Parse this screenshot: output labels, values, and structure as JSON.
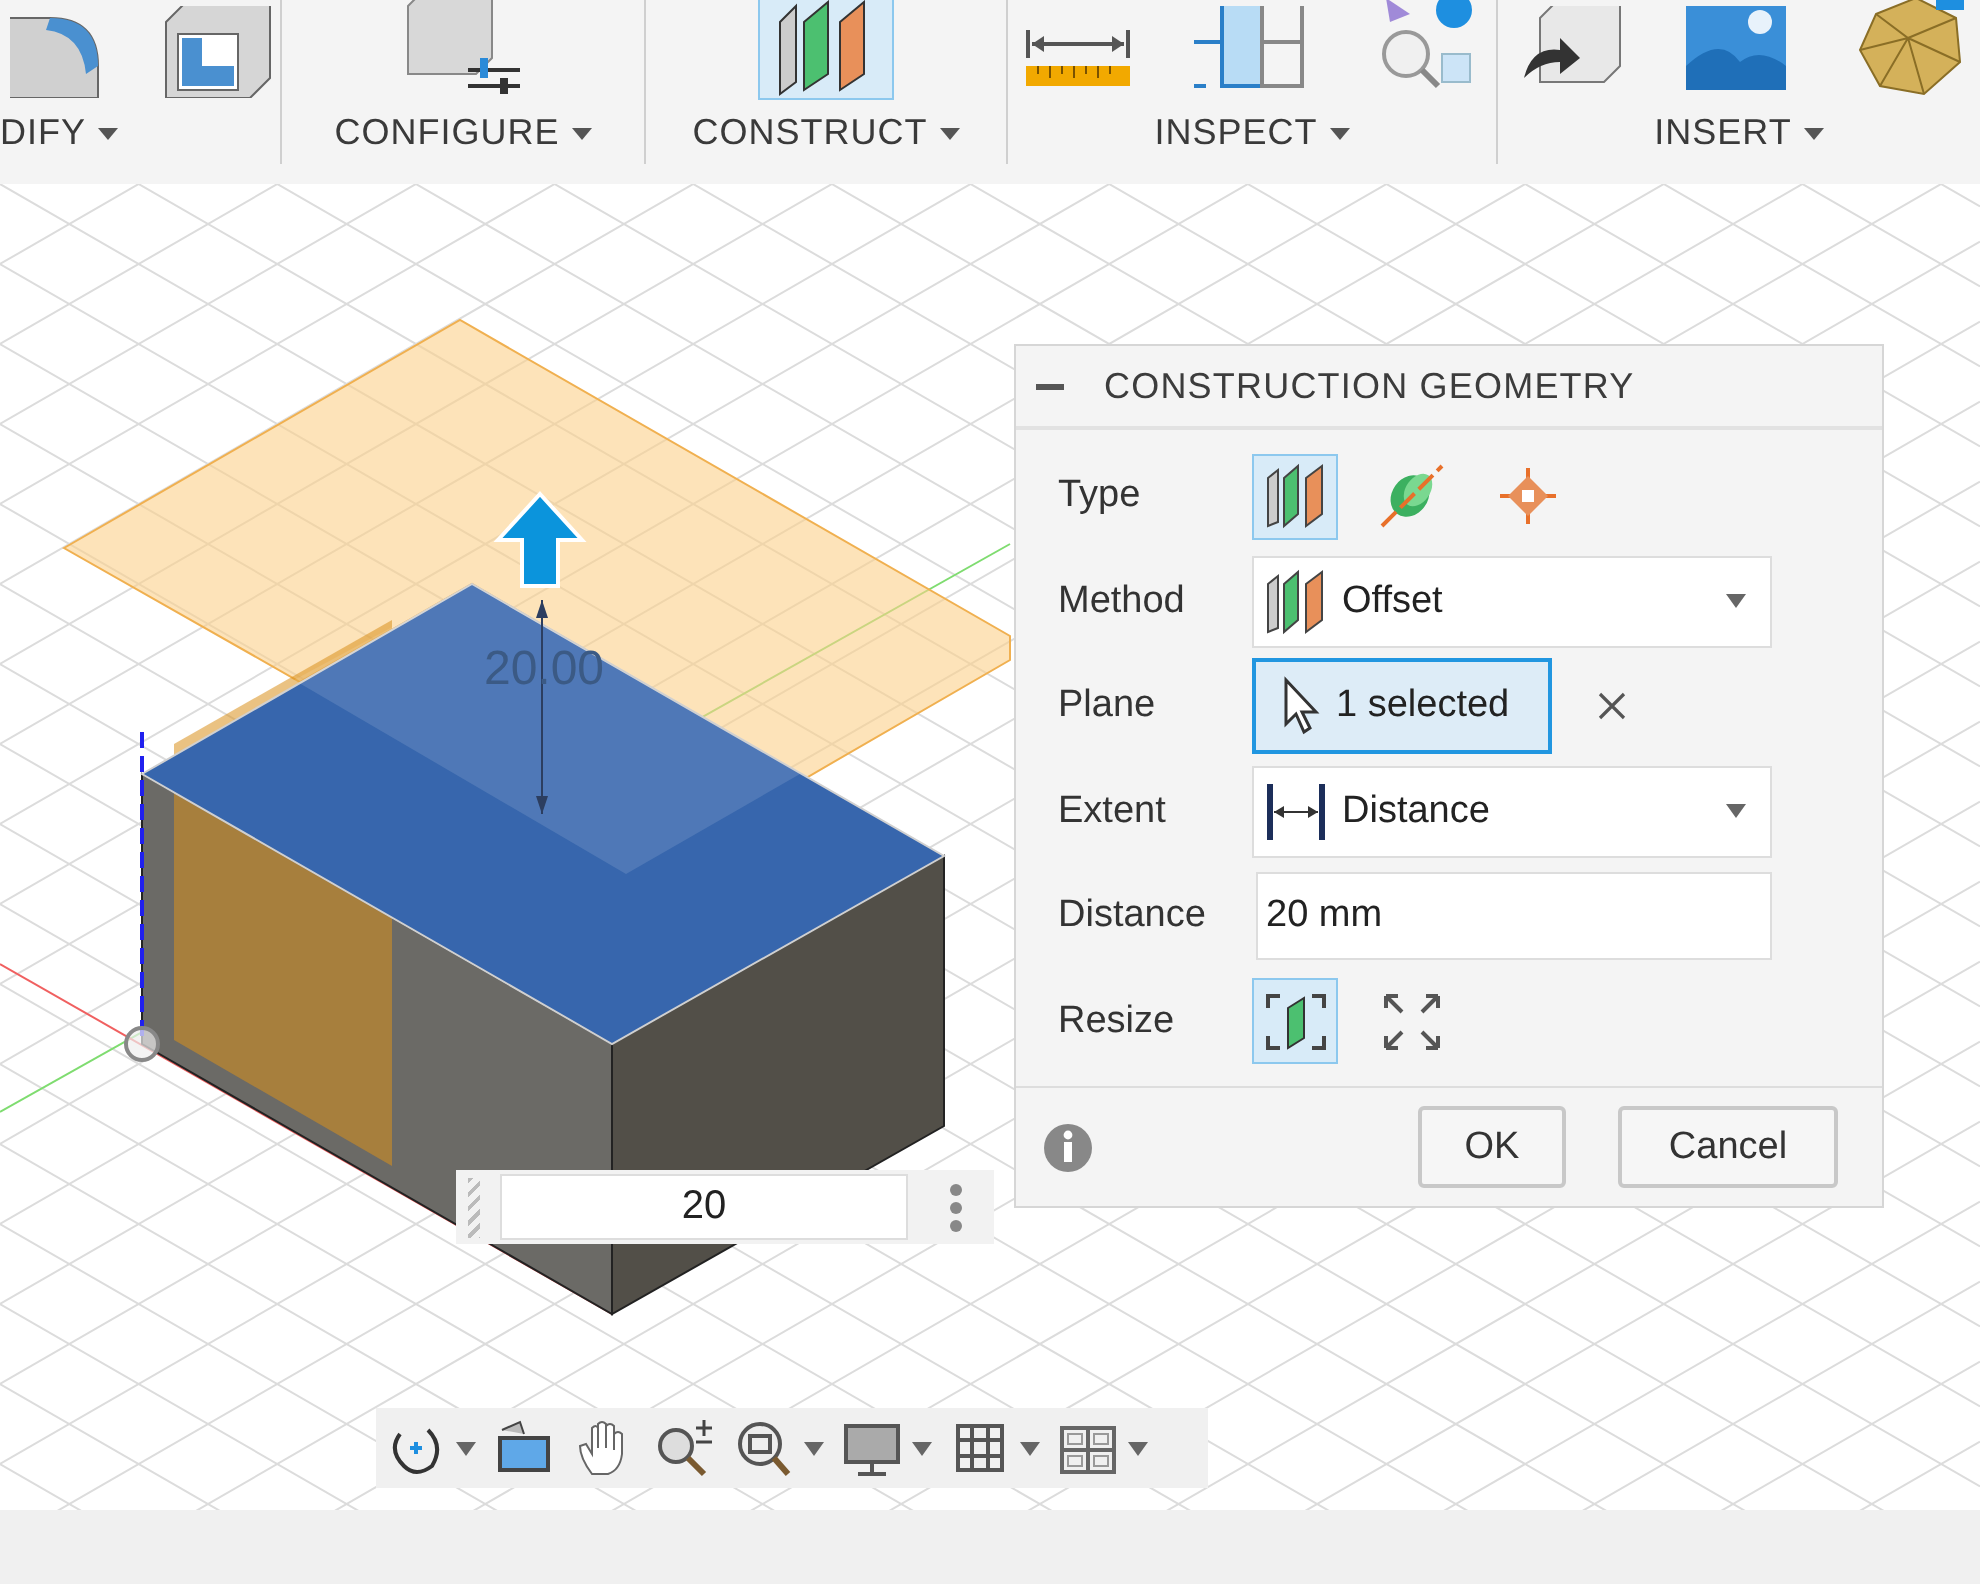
{
  "toolbar": {
    "groups": [
      {
        "label": "DIFY",
        "tools": [
          {
            "kind": "fillet",
            "selected": false
          },
          {
            "kind": "shell",
            "selected": false
          }
        ]
      },
      {
        "label": "CONFIGURE",
        "tools": [
          {
            "kind": "configure",
            "selected": false
          }
        ]
      },
      {
        "label": "CONSTRUCT",
        "tools": [
          {
            "kind": "plane",
            "selected": true
          }
        ]
      },
      {
        "label": "INSPECT",
        "tools": [
          {
            "kind": "measure",
            "selected": false
          },
          {
            "kind": "section",
            "selected": false
          },
          {
            "kind": "interference",
            "selected": false
          }
        ]
      },
      {
        "label": "INSERT",
        "tools": [
          {
            "kind": "derive",
            "selected": false
          },
          {
            "kind": "image",
            "selected": false
          },
          {
            "kind": "mesh",
            "selected": false
          }
        ]
      }
    ]
  },
  "viewport": {
    "dimension_label": "20.00",
    "value_input": {
      "value": "20"
    }
  },
  "dialog": {
    "title": "CONSTRUCTION GEOMETRY",
    "rows": [
      {
        "kind": "choices",
        "label": "Type",
        "options": [
          {
            "selected": true
          },
          {
            "selected": false
          },
          {
            "selected": false
          }
        ]
      },
      {
        "kind": "dropdown",
        "label": "Method",
        "value": "Offset"
      },
      {
        "kind": "selection",
        "label": "Plane",
        "value": "1 selected"
      },
      {
        "kind": "dropdown",
        "label": "Extent",
        "value": "Distance"
      },
      {
        "kind": "input",
        "label": "Distance",
        "value": "20 mm"
      },
      {
        "kind": "choices",
        "label": "Resize",
        "options": [
          {
            "selected": true
          },
          {
            "selected": false
          }
        ]
      }
    ],
    "buttons": [
      "OK",
      "Cancel"
    ]
  },
  "navigation_bar": {
    "tools": [
      {
        "kind": "orbit",
        "dropdown": true
      },
      {
        "kind": "look",
        "dropdown": false
      },
      {
        "kind": "pan",
        "dropdown": false
      },
      {
        "kind": "zoom",
        "dropdown": false
      },
      {
        "kind": "fit",
        "dropdown": true
      },
      {
        "kind": "display",
        "dropdown": true
      },
      {
        "kind": "grid",
        "dropdown": true
      },
      {
        "kind": "viewports",
        "dropdown": true
      }
    ]
  }
}
